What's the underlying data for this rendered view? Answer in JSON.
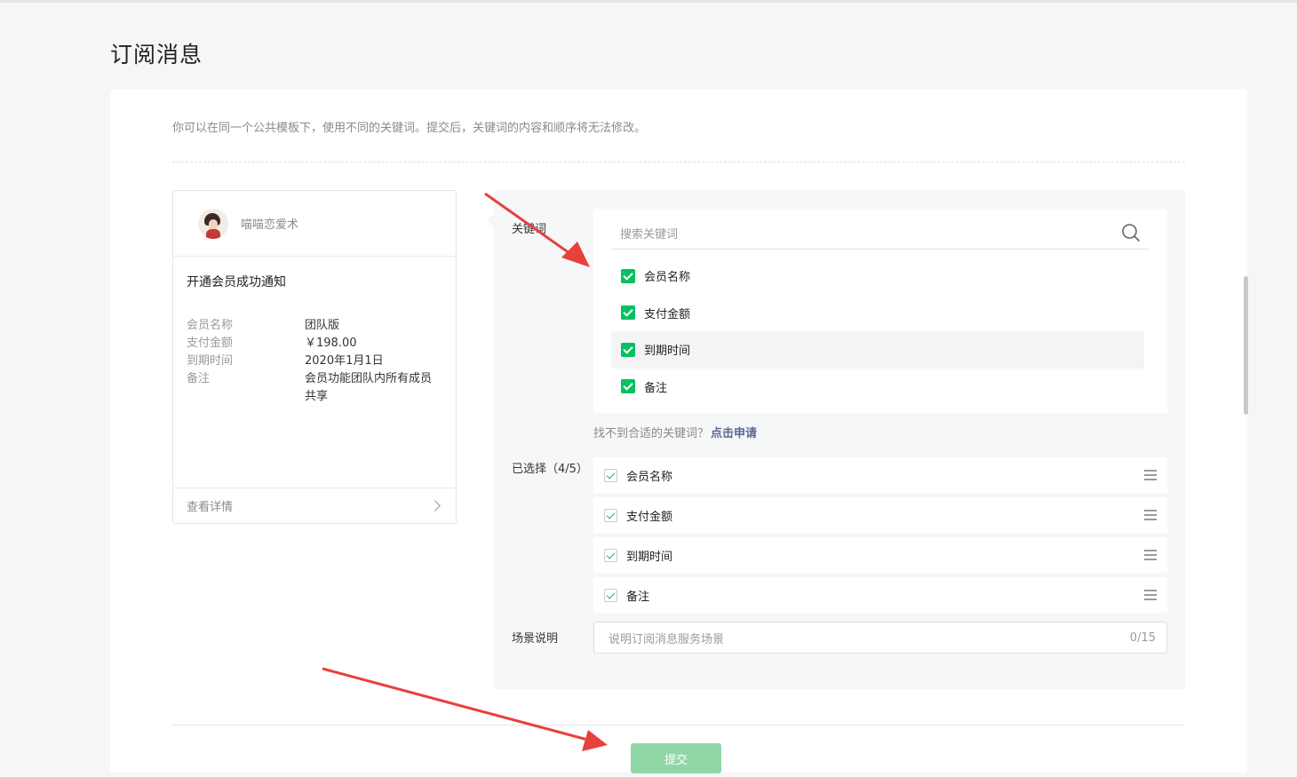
{
  "page": {
    "title": "订阅消息"
  },
  "hint": "你可以在同一个公共模板下，使用不同的关键词。提交后，关键词的内容和顺序将无法修改。",
  "preview": {
    "account_name": "喵喵恋爱术",
    "message_title": "开通会员成功通知",
    "rows": [
      {
        "key": "会员名称",
        "value": "团队版"
      },
      {
        "key": "支付金额",
        "value": "￥198.00"
      },
      {
        "key": "到期时间",
        "value": "2020年1月1日"
      },
      {
        "key": "备注",
        "value": "会员功能团队内所有成员共享"
      }
    ],
    "footer_label": "查看详情"
  },
  "keywords": {
    "label": "关键词",
    "search_placeholder": "搜索关键词",
    "items": [
      {
        "label": "会员名称",
        "checked": true
      },
      {
        "label": "支付金额",
        "checked": true
      },
      {
        "label": "到期时间",
        "checked": true
      },
      {
        "label": "备注",
        "checked": true
      }
    ],
    "not_found_text": "找不到合适的关键词？",
    "apply_link": "点击申请"
  },
  "selected": {
    "label": "已选择（4/5）",
    "items": [
      "会员名称",
      "支付金额",
      "到期时间",
      "备注"
    ]
  },
  "scene": {
    "label": "场景说明",
    "placeholder": "说明订阅消息服务场景",
    "counter": "0/15"
  },
  "submit_label": "提交",
  "colors": {
    "accent": "#07c160",
    "submit_disabled": "#8fd8a6",
    "link": "#576b95",
    "annotation_arrow": "#e8403a"
  }
}
